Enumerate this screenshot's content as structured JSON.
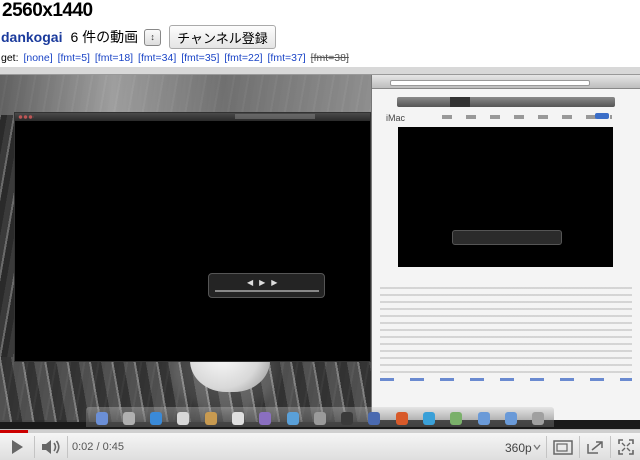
{
  "page": {
    "title": "2560x1440",
    "owner": "dankogai",
    "video_count": "6 件の動画",
    "subscribe_label": "チャンネル登録"
  },
  "download": {
    "prefix": "get:",
    "links": [
      {
        "label": "[none]",
        "struck": false
      },
      {
        "label": "[fmt=5]",
        "struck": false
      },
      {
        "label": "[fmt=18]",
        "struck": false
      },
      {
        "label": "[fmt=34]",
        "struck": false
      },
      {
        "label": "[fmt=35]",
        "struck": false
      },
      {
        "label": "[fmt=22]",
        "struck": false
      },
      {
        "label": "[fmt=37]",
        "struck": false
      },
      {
        "label": "[fmt=38]",
        "struck": true
      }
    ]
  },
  "video_frame": {
    "browser_heading": "iMac"
  },
  "player": {
    "current_time": "0:02",
    "duration": "0:45",
    "time_display": "0:02 / 0:45",
    "quality": "360p",
    "progress_fraction": 0.044,
    "accent": "#cc0000"
  },
  "icons": [
    "play-icon",
    "volume-icon",
    "expand-icon",
    "popout-icon",
    "fullscreen-icon",
    "dropdown-chevron-icon"
  ]
}
